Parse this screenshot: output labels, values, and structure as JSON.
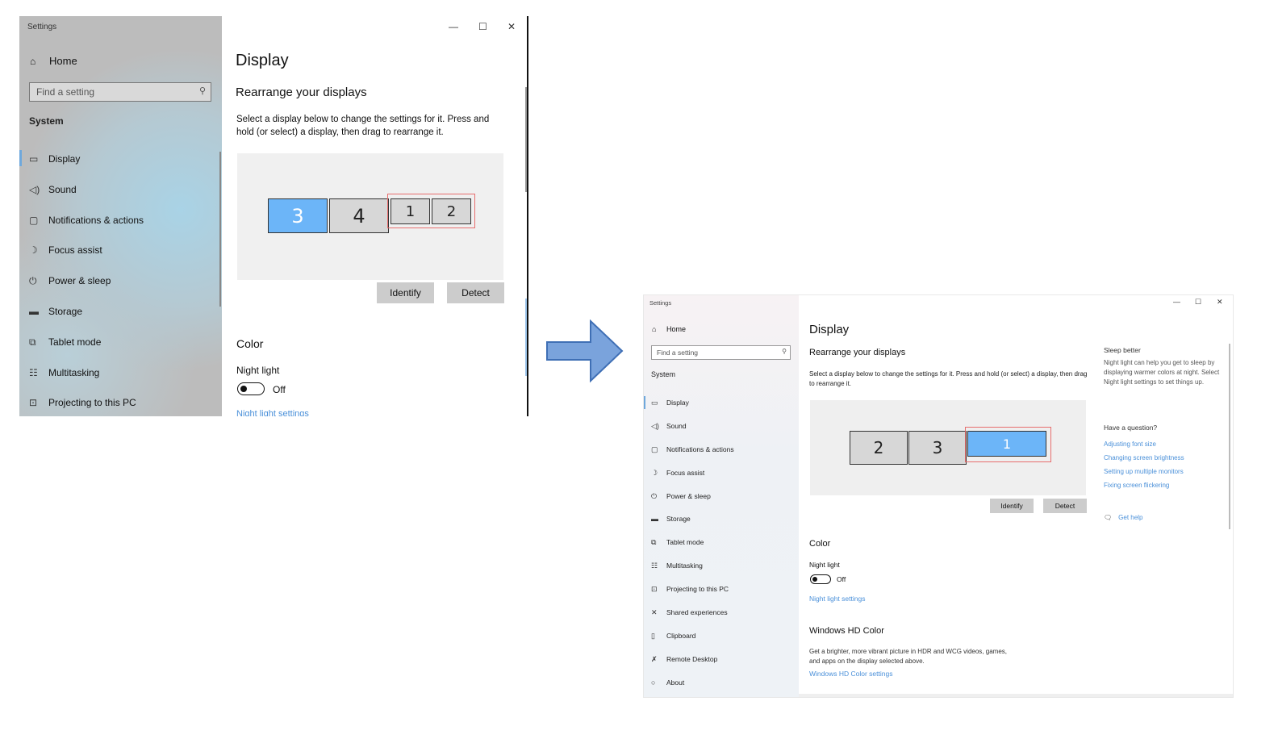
{
  "before": {
    "app_title": "Settings",
    "home_label": "Home",
    "search_placeholder": "Find a setting",
    "section_heading": "System",
    "nav_items": [
      {
        "icon": "monitor-icon",
        "glyph": "▭",
        "label": "Display",
        "selected": true
      },
      {
        "icon": "speaker-icon",
        "glyph": "◁)",
        "label": "Sound",
        "selected": false
      },
      {
        "icon": "notifications-icon",
        "glyph": "▢",
        "label": "Notifications & actions",
        "selected": false
      },
      {
        "icon": "moon-icon",
        "glyph": "☽",
        "label": "Focus assist",
        "selected": false
      },
      {
        "icon": "power-icon",
        "glyph": "⏻",
        "label": "Power & sleep",
        "selected": false
      },
      {
        "icon": "storage-icon",
        "glyph": "▬",
        "label": "Storage",
        "selected": false
      },
      {
        "icon": "tablet-icon",
        "glyph": "⧉",
        "label": "Tablet mode",
        "selected": false
      },
      {
        "icon": "multitasking-icon",
        "glyph": "☷",
        "label": "Multitasking",
        "selected": false
      },
      {
        "icon": "projector-icon",
        "glyph": "⊡",
        "label": "Projecting to this PC",
        "selected": false
      }
    ],
    "page_title": "Display",
    "rearrange_heading": "Rearrange your displays",
    "rearrange_desc": "Select a display below to change the settings for it. Press and hold (or select) a display, then drag to rearrange it.",
    "monitors": [
      "3",
      "4",
      "1",
      "2"
    ],
    "active_monitor": "3",
    "selected_monitors": [
      "1",
      "2"
    ],
    "identify_label": "Identify",
    "detect_label": "Detect",
    "color_heading": "Color",
    "night_light_label": "Night light",
    "night_light_state": "Off",
    "night_light_settings_link": "Night light settings"
  },
  "after": {
    "app_title": "Settings",
    "home_label": "Home",
    "search_placeholder": "Find a setting",
    "section_heading": "System",
    "nav_items": [
      {
        "icon": "monitor-icon",
        "glyph": "▭",
        "label": "Display",
        "selected": true
      },
      {
        "icon": "speaker-icon",
        "glyph": "◁)",
        "label": "Sound",
        "selected": false
      },
      {
        "icon": "notifications-icon",
        "glyph": "▢",
        "label": "Notifications & actions",
        "selected": false
      },
      {
        "icon": "moon-icon",
        "glyph": "☽",
        "label": "Focus assist",
        "selected": false
      },
      {
        "icon": "power-icon",
        "glyph": "⏻",
        "label": "Power & sleep",
        "selected": false
      },
      {
        "icon": "storage-icon",
        "glyph": "▬",
        "label": "Storage",
        "selected": false
      },
      {
        "icon": "tablet-icon",
        "glyph": "⧉",
        "label": "Tablet mode",
        "selected": false
      },
      {
        "icon": "multitasking-icon",
        "glyph": "☷",
        "label": "Multitasking",
        "selected": false
      },
      {
        "icon": "projector-icon",
        "glyph": "⊡",
        "label": "Projecting to this PC",
        "selected": false
      },
      {
        "icon": "shared-experiences-icon",
        "glyph": "✕",
        "label": "Shared experiences",
        "selected": false
      },
      {
        "icon": "clipboard-icon",
        "glyph": "▯",
        "label": "Clipboard",
        "selected": false
      },
      {
        "icon": "remote-desktop-icon",
        "glyph": "✗",
        "label": "Remote Desktop",
        "selected": false
      },
      {
        "icon": "info-icon",
        "glyph": "○",
        "label": "About",
        "selected": false
      }
    ],
    "page_title": "Display",
    "rearrange_heading": "Rearrange your displays",
    "rearrange_desc": "Select a display below to change the settings for it. Press and hold (or select) a display, then drag to rearrange it.",
    "monitors": [
      "2",
      "3",
      "1"
    ],
    "active_monitor": "1",
    "selected_monitors": [
      "1"
    ],
    "identify_label": "Identify",
    "detect_label": "Detect",
    "color_heading": "Color",
    "night_light_label": "Night light",
    "night_light_state": "Off",
    "night_light_settings_link": "Night light settings",
    "hd_color_heading": "Windows HD Color",
    "hd_color_desc": "Get a brighter, more vibrant picture in HDR and WCG videos, games, and apps on the display selected above.",
    "hd_color_link": "Windows HD Color settings",
    "right_panel": {
      "sleep_heading": "Sleep better",
      "sleep_text": "Night light can help you get to sleep by displaying warmer colors at night. Select Night light settings to set things up.",
      "question_heading": "Have a question?",
      "links": [
        "Adjusting font size",
        "Changing screen brightness",
        "Setting up multiple monitors",
        "Fixing screen flickering"
      ],
      "get_help": "Get help"
    }
  },
  "colors": {
    "active_monitor": "#6cb5f8",
    "selection_outline": "#e76e6e",
    "link": "#4a90d9",
    "arrow_fill": "#7aa3dc",
    "arrow_stroke": "#3f6fb5"
  }
}
